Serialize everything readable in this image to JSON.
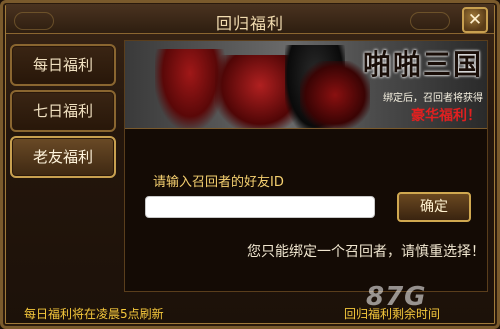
{
  "window": {
    "title": "回归福利",
    "close_label": "✕"
  },
  "sidebar": {
    "items": [
      {
        "label": "每日福利",
        "active": false
      },
      {
        "label": "七日福利",
        "active": false
      },
      {
        "label": "老友福利",
        "active": true
      }
    ]
  },
  "banner": {
    "logo": "啪啪三国",
    "subtitle": "绑定后，召回者将获得",
    "cta": "豪华福利！"
  },
  "form": {
    "prompt": "请输入召回者的好友ID",
    "input_value": "",
    "confirm_label": "确定",
    "notice": "您只能绑定一个召回者，请慎重选择！"
  },
  "footer": {
    "left_text": "每日福利将在凌晨5点刷新",
    "right_text": "回归福利剩余时间"
  },
  "watermark": "87G",
  "colors": {
    "accent_gold": "#f5c83c",
    "border_gold": "#c8a050",
    "banner_red": "#e02020"
  }
}
